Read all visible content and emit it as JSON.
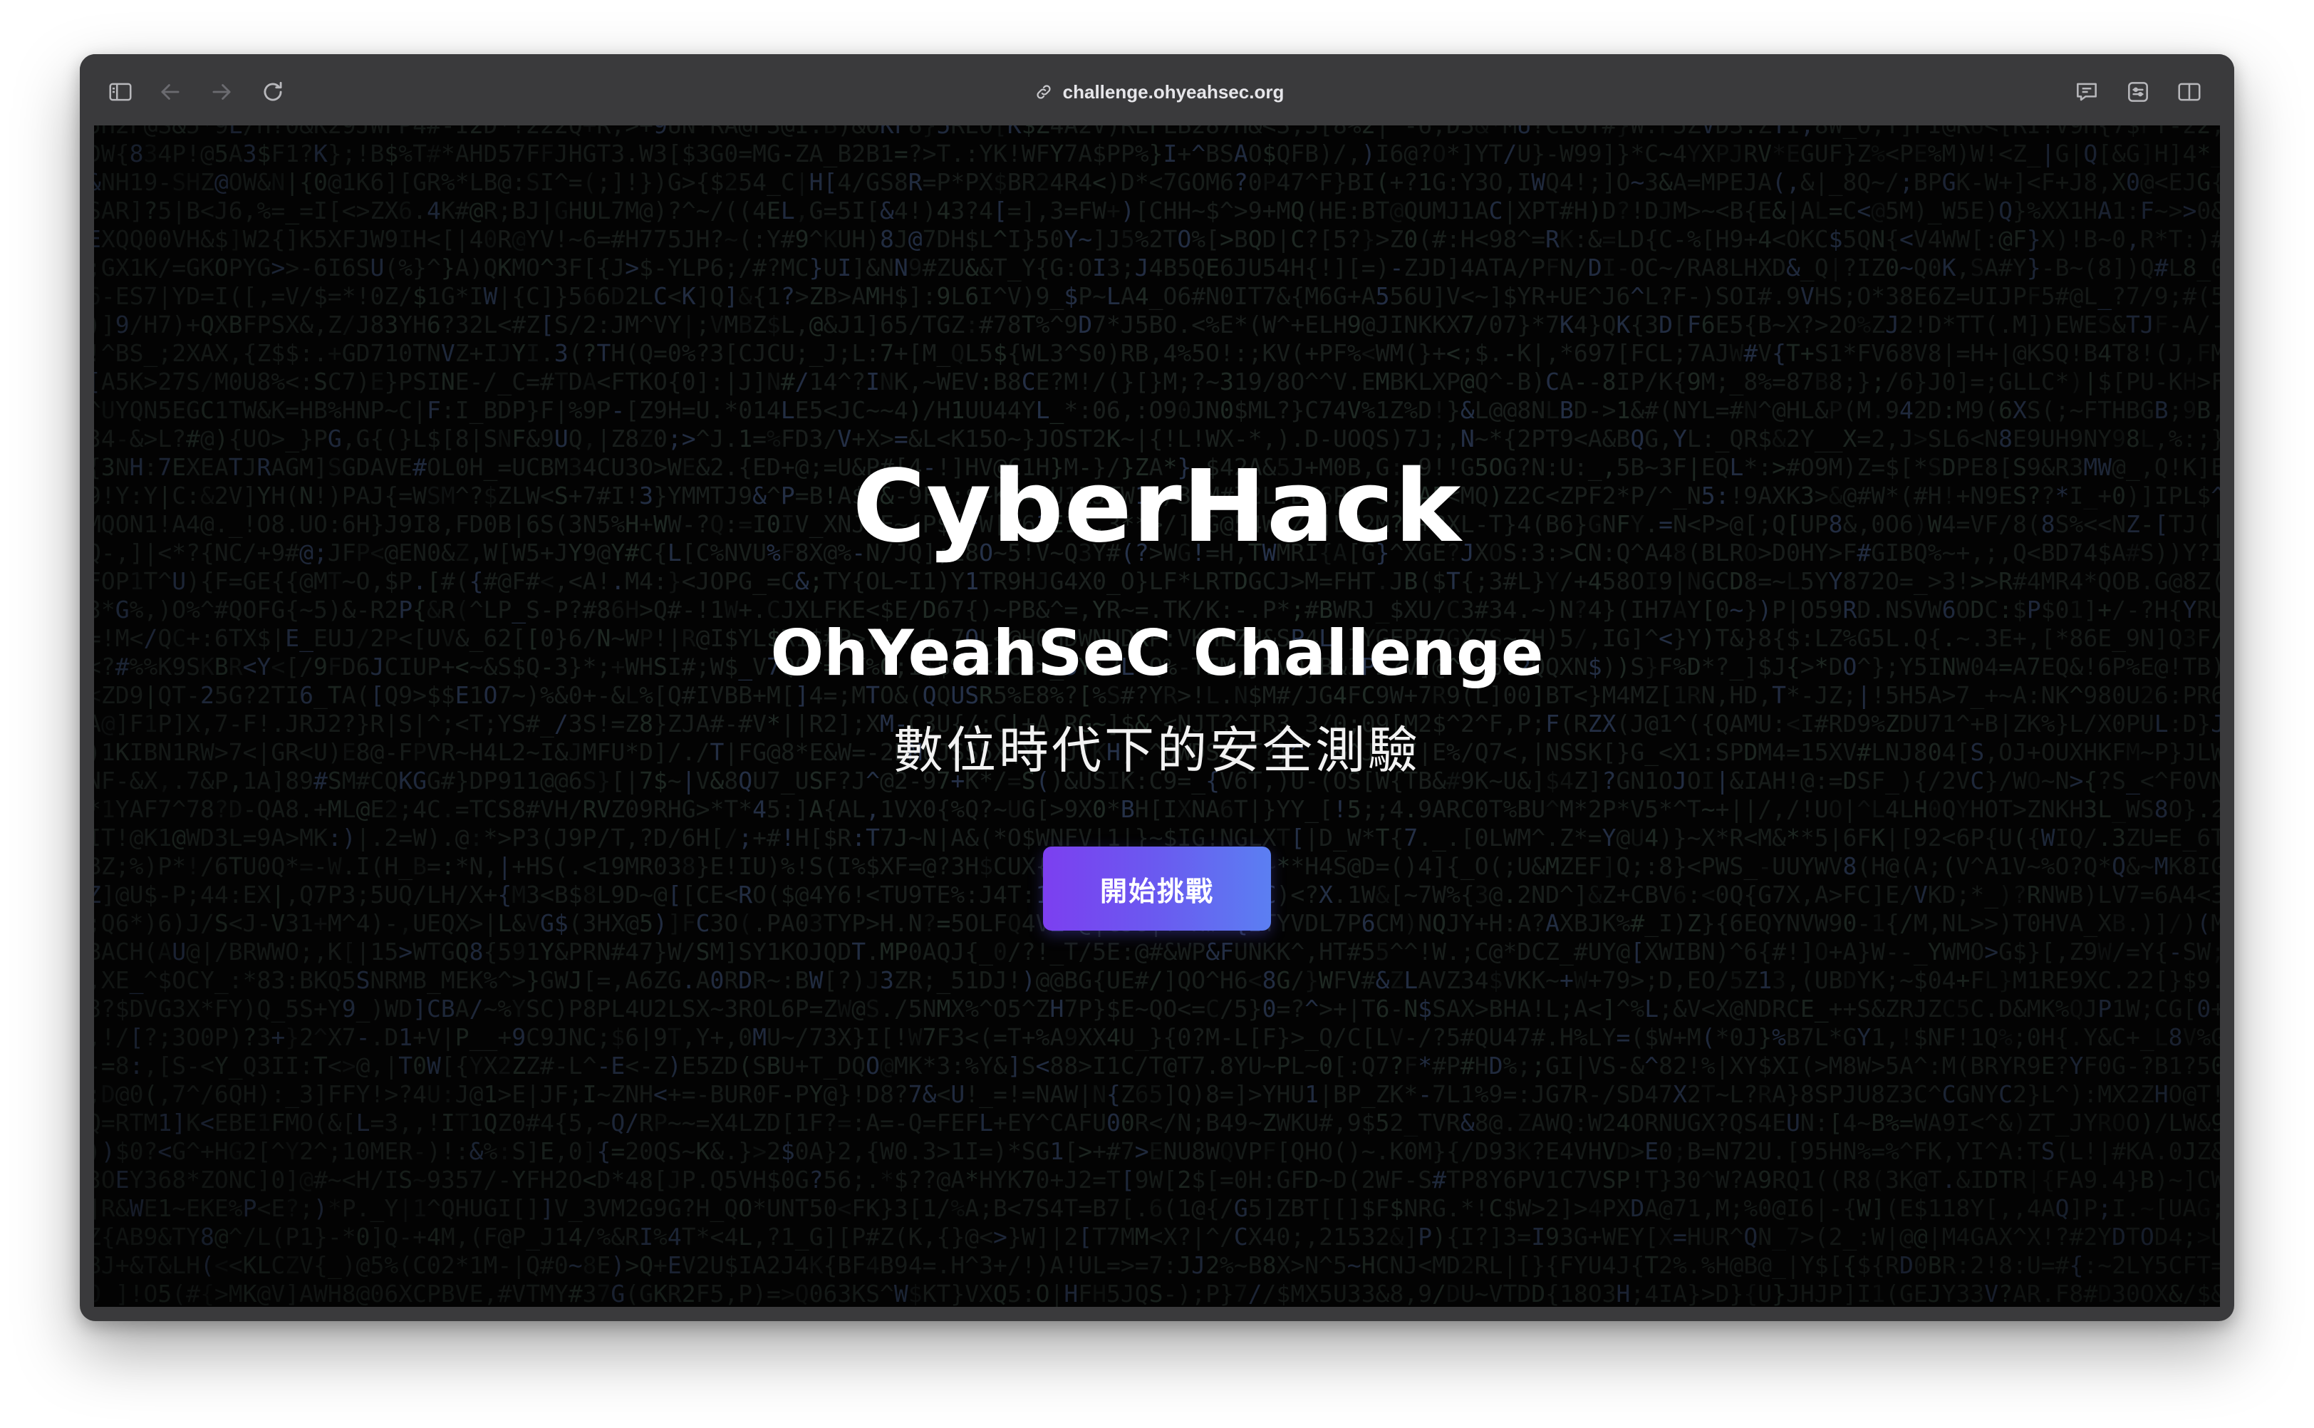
{
  "browser": {
    "url": "challenge.ohyeahsec.org",
    "icons": {
      "sidebar": "sidebar-toggle-icon",
      "back": "back-arrow-icon",
      "forward": "forward-arrow-icon",
      "reload": "reload-icon",
      "lock": "lock-icon",
      "translate": "speech-bubble-icon",
      "reader": "reader-icon",
      "split": "split-view-icon"
    }
  },
  "hero": {
    "title": "CyberHack",
    "subtitle": "OhYeahSeC Challenge",
    "tagline": "數位時代下的安全測驗",
    "cta_label": "開始挑戰"
  },
  "colors": {
    "background": "#030303",
    "cta_start": "#7c3ff0",
    "cta_end": "#5b7ff2",
    "matrix_text": "#1f2623"
  }
}
